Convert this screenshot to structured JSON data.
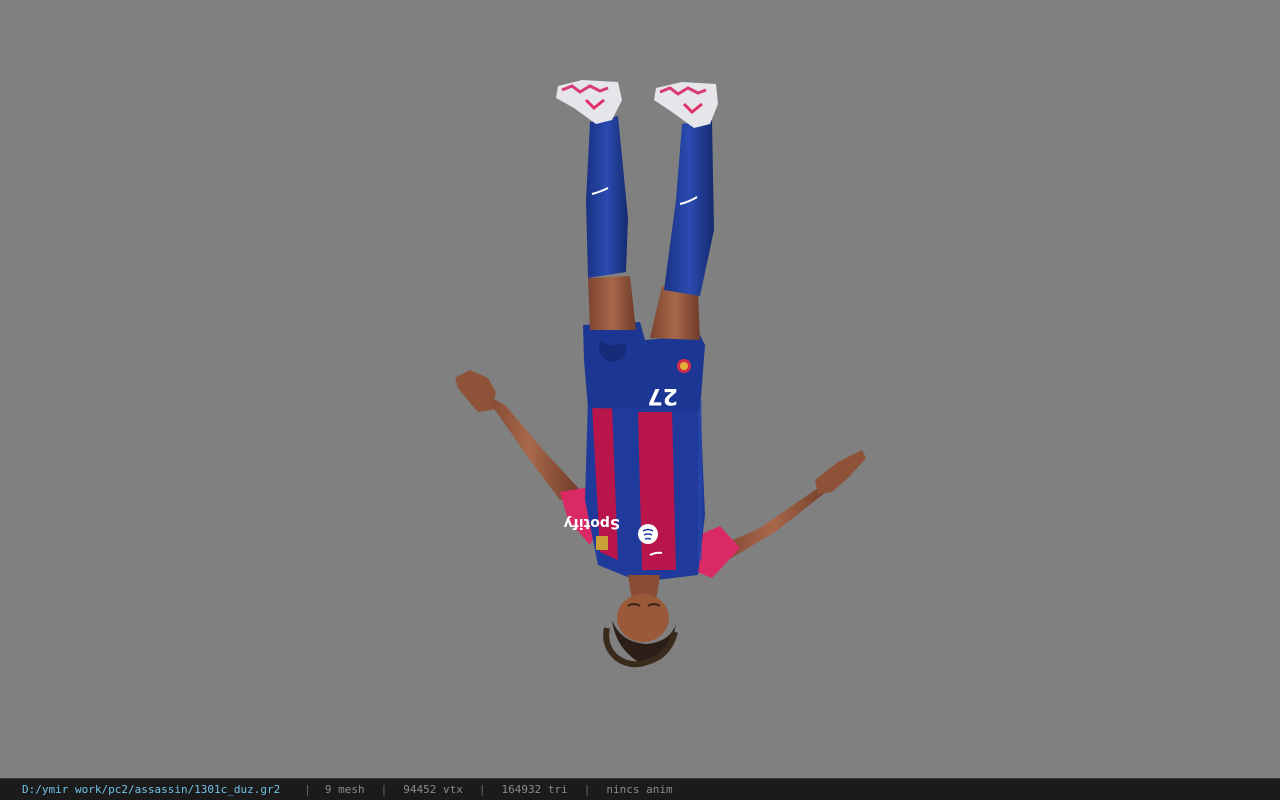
{
  "viewport": {
    "model_icon": "upside-down-footballer-model",
    "colors": {
      "background": "#808080",
      "kit_blue": "#1f3a9a",
      "kit_red": "#b8154a",
      "sleeve_pink": "#e0306a",
      "skin": "#9a5a3a",
      "boot": "#e6e6ea"
    },
    "shirt_number": "27",
    "sponsor": "Spotify"
  },
  "statusbar": {
    "file_path": "D:/ymir work/pc2/assassin/1301c_duz.gr2",
    "separator": "|",
    "mesh": "9 mesh",
    "vertices": "94452 vtx",
    "triangles": "164932 tri",
    "animation": "nincs anim"
  }
}
